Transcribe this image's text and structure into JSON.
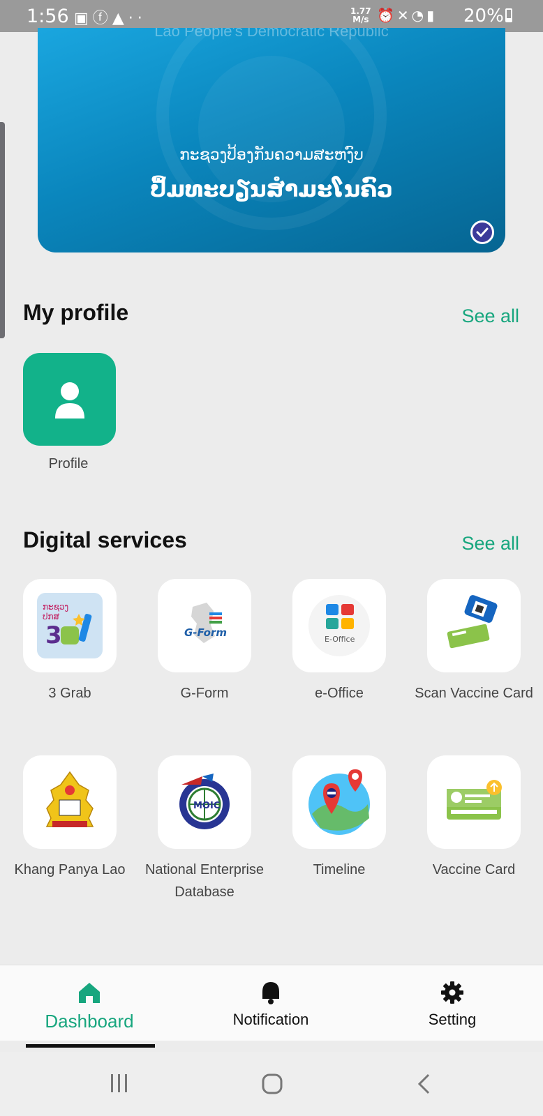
{
  "status_bar": {
    "time": "1:56",
    "left_icons": [
      "gallery-icon",
      "facebook-icon",
      "warning-icon",
      "more-dots-icon"
    ],
    "network_speed_value": "1.77",
    "network_speed_unit": "M/s",
    "right_icons": [
      "alarm-icon",
      "mute-icon",
      "wifi-icon",
      "signal-icon"
    ],
    "battery": "20%"
  },
  "banner": {
    "top_text": "Lao People's Democratic Republic",
    "subtitle": "ກະຊວງປ້ອງກັນຄວາມສະຫງົບ",
    "title": "ປຶ້ມທະບຽນສຳມະໂນຄົວ",
    "verified_icon": "check-circle-icon"
  },
  "my_profile": {
    "title": "My profile",
    "see_all": "See all",
    "items": [
      {
        "label": "Profile",
        "icon": "person-icon",
        "color": "#12b28a"
      }
    ]
  },
  "digital_services": {
    "title": "Digital services",
    "see_all": "See all",
    "items": [
      {
        "label": "3 Grab",
        "icon": "three-grab-logo"
      },
      {
        "label": "G-Form",
        "icon": "g-form-logo"
      },
      {
        "label": "e-Office",
        "icon": "e-office-logo"
      },
      {
        "label": "Scan Vaccine Card",
        "icon": "phone-qr-card-icon"
      },
      {
        "label": "Khang Panya Lao",
        "icon": "khang-panya-lao-logo"
      },
      {
        "label": "National Enterprise Database",
        "icon": "moic-logo"
      },
      {
        "label": "Timeline",
        "icon": "map-pin-timeline-icon"
      },
      {
        "label": "Vaccine Card",
        "icon": "vaccine-card-icon"
      }
    ]
  },
  "bottom_nav": {
    "items": [
      {
        "label": "Dashboard",
        "icon": "home-icon",
        "active": true
      },
      {
        "label": "Notification",
        "icon": "bell-icon",
        "active": false
      },
      {
        "label": "Setting",
        "icon": "gear-icon",
        "active": false
      }
    ]
  },
  "colors": {
    "accent": "#17a67e",
    "banner": "#0a86bd"
  }
}
